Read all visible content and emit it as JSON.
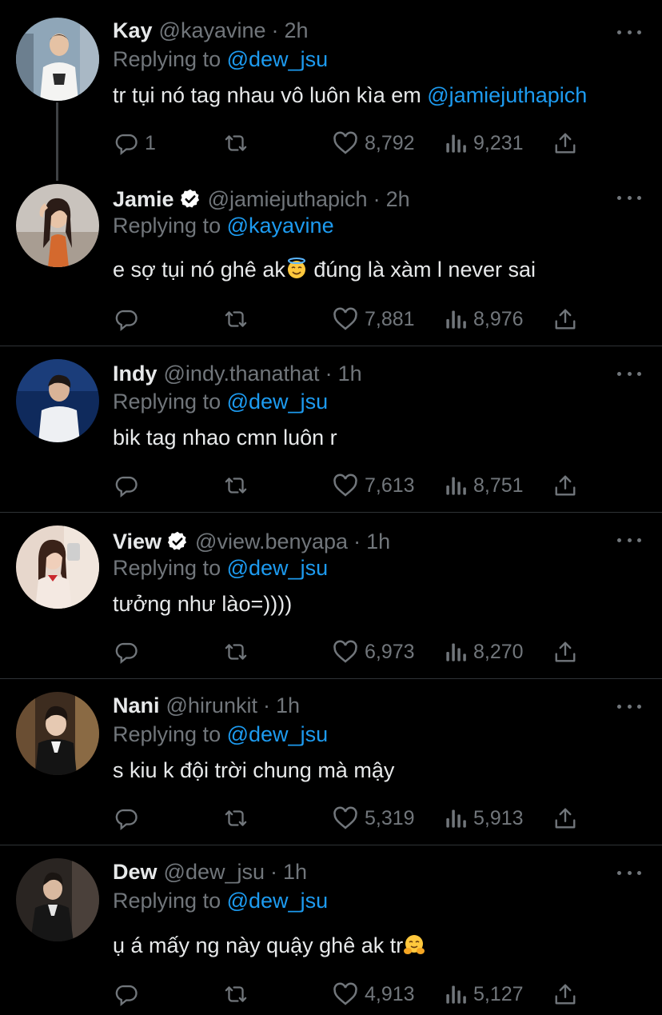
{
  "reply_prefix": "Replying to",
  "tweets": [
    {
      "name": "Kay",
      "handle": "@kayavine",
      "separator": "·",
      "time": "2h",
      "verified": false,
      "replying_to": "@dew_jsu",
      "text": "tr tụi nó tag nhau vô luôn kìa em",
      "text_mention": "@jamiejuthapich",
      "emoji": "",
      "replies": "1",
      "retweets": "",
      "likes": "8,792",
      "views": "9,231"
    },
    {
      "name": "Jamie",
      "handle": "@jamiejuthapich",
      "separator": "·",
      "time": "2h",
      "verified": true,
      "replying_to": "@kayavine",
      "text": "e sợ tụi nó ghê ak",
      "emoji": "smiling-face-with-halo",
      "text_after": " đúng là xàm l never sai",
      "replies": "",
      "retweets": "",
      "likes": "7,881",
      "views": "8,976"
    },
    {
      "name": "Indy",
      "handle": "@indy.thanathat",
      "separator": "·",
      "time": "1h",
      "verified": false,
      "replying_to": "@dew_jsu",
      "text": "bik tag nhao cmn luôn r",
      "replies": "",
      "retweets": "",
      "likes": "7,613",
      "views": "8,751"
    },
    {
      "name": "View",
      "handle": "@view.benyapa",
      "separator": "·",
      "time": "1h",
      "verified": true,
      "replying_to": "@dew_jsu",
      "text": "tưởng như lào=))))",
      "replies": "",
      "retweets": "",
      "likes": "6,973",
      "views": "8,270"
    },
    {
      "name": "Nani",
      "handle": "@hirunkit",
      "separator": "·",
      "time": "1h",
      "verified": false,
      "replying_to": "@dew_jsu",
      "text": "s kiu k đội trời chung mà mậy",
      "replies": "",
      "retweets": "",
      "likes": "5,319",
      "views": "5,913"
    },
    {
      "name": "Dew",
      "handle": "@dew_jsu",
      "separator": "·",
      "time": "1h",
      "verified": false,
      "replying_to": "@dew_jsu",
      "text": "ụ á mấy ng này quậy ghê ak tr",
      "emoji": "hugging-face",
      "replies": "",
      "retweets": "",
      "likes": "4,913",
      "views": "5,127"
    }
  ],
  "icons": {
    "reply": "reply-icon",
    "retweet": "retweet-icon",
    "like": "heart-icon",
    "views": "views-icon",
    "share": "share-icon",
    "more": "more-icon",
    "verified": "verified-badge-icon"
  },
  "colors": {
    "background": "#000000",
    "text": "#e7e9ea",
    "muted": "#71767b",
    "accent": "#1d9bf0",
    "divider": "#2f3336"
  }
}
